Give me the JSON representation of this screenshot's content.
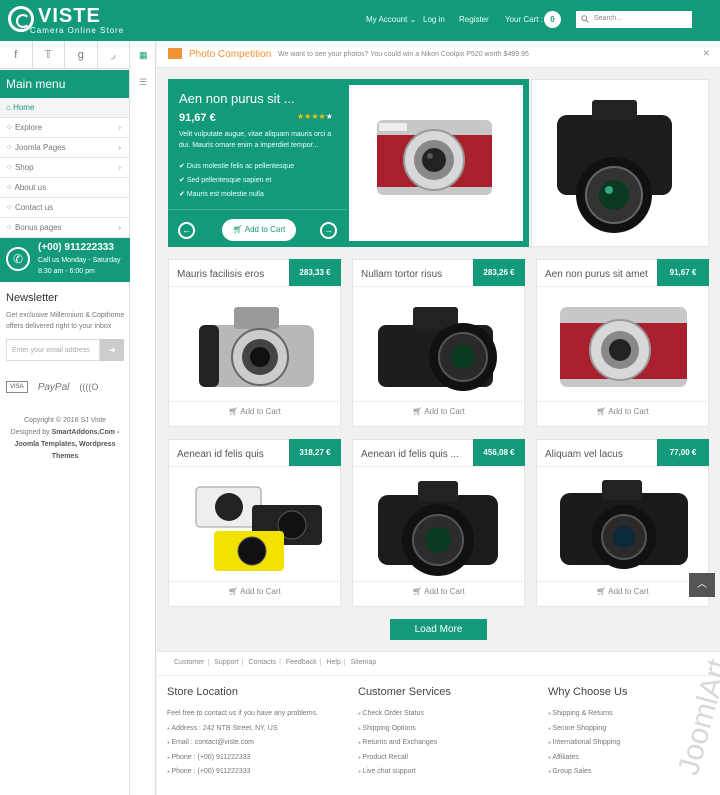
{
  "brand": {
    "name": "VISTE",
    "tagline": "Camera Online Store"
  },
  "header": {
    "my_account": "My Account ⌄",
    "login": "Log in",
    "register": "Register",
    "your_cart": "Your Cart :",
    "cart_count": "0",
    "search_placeholder": "Search..."
  },
  "sidebar": {
    "social": [
      "f",
      "t",
      "g",
      "rss"
    ],
    "menu_title": "Main menu",
    "items": [
      {
        "label": "Home",
        "active": true
      },
      {
        "label": "Explore"
      },
      {
        "label": "Joomla Pages"
      },
      {
        "label": "Shop"
      },
      {
        "label": "About us"
      },
      {
        "label": "Contact us"
      },
      {
        "label": "Bonus pages"
      }
    ],
    "hotline": {
      "number": "(+00) 911222333",
      "line1": "Call us Monday - Saturday",
      "line2": "8:30 am - 6:00 pm"
    },
    "newsletter": {
      "title": "Newsletter",
      "desc": "Get exclusive Millennium & Copthome offers delivered right to your inbox",
      "placeholder": "Enter your email address"
    },
    "payments": {
      "visa": "VISA",
      "paypal": "PayPal",
      "other": "((((O"
    },
    "copyright": {
      "line1": "Copyright © 2016 SJ Viste",
      "line2a": "Designed by",
      "line2b": "SmartAddons.Com -",
      "line3": "Joomla Templates, Wordpress",
      "line4": "Themes"
    }
  },
  "promo": {
    "title": "Photo Competition",
    "text": "We want to see your photos? You could win a Nikon Coolpix P520 worth $499.95"
  },
  "hero": {
    "name": "Aen non purus sit ...",
    "price": "91,67 €",
    "rating": 4,
    "desc": "Velit vulputate augue, vitae aliquam mauris orci a dui. Mauris ornare enim a imperdiet tempor...",
    "bullets": [
      "Duis molestie felis ac pellentesque",
      "Sed pellentesque sapien et",
      "Mauris est molestie nulla"
    ],
    "add_to_cart": "Add to Cart"
  },
  "products": [
    {
      "name": "Mauris facilisis eros",
      "price": "283,33 €",
      "cart": "Add to Cart"
    },
    {
      "name": "Nullam tortor risus",
      "price": "283,26 €",
      "cart": "Add to Cart"
    },
    {
      "name": "Aen non purus sit amet",
      "price": "91,67 €",
      "cart": "Add to Cart"
    },
    {
      "name": "Aenean id felis quis",
      "price": "318,27 €",
      "cart": "Add to Cart"
    },
    {
      "name": "Aenean id felis quis ...",
      "price": "456,08 €",
      "cart": "Add to Cart"
    },
    {
      "name": "Aliquam vel lacus",
      "price": "77,00 €",
      "cart": "Add to Cart"
    }
  ],
  "load_more": "Load More",
  "footer": {
    "links": [
      "Customer",
      "Support",
      "Contacts",
      "Feedback",
      "Help",
      "Sitemap"
    ],
    "store": {
      "title": "Store Location",
      "intro": "Feel free to contact us if you have any problems.",
      "address": "Address : 242 NTB Street, NY, US",
      "email": "Email : contact@viste.com",
      "phone1": "Phone : (+00) 911222333",
      "phone2": "Phone : (+00) 911222333"
    },
    "services": {
      "title": "Customer Services",
      "items": [
        "Check Order Status",
        "Shipping Options",
        "Returns and Exchanges",
        "Product Recall",
        "Live chat support"
      ]
    },
    "why": {
      "title": "Why Choose Us",
      "items": [
        "Shipping & Returns",
        "Secure Shopping",
        "International Shipping",
        "Affiliates",
        "Group Sales"
      ]
    }
  },
  "watermark": "JoomlArt"
}
